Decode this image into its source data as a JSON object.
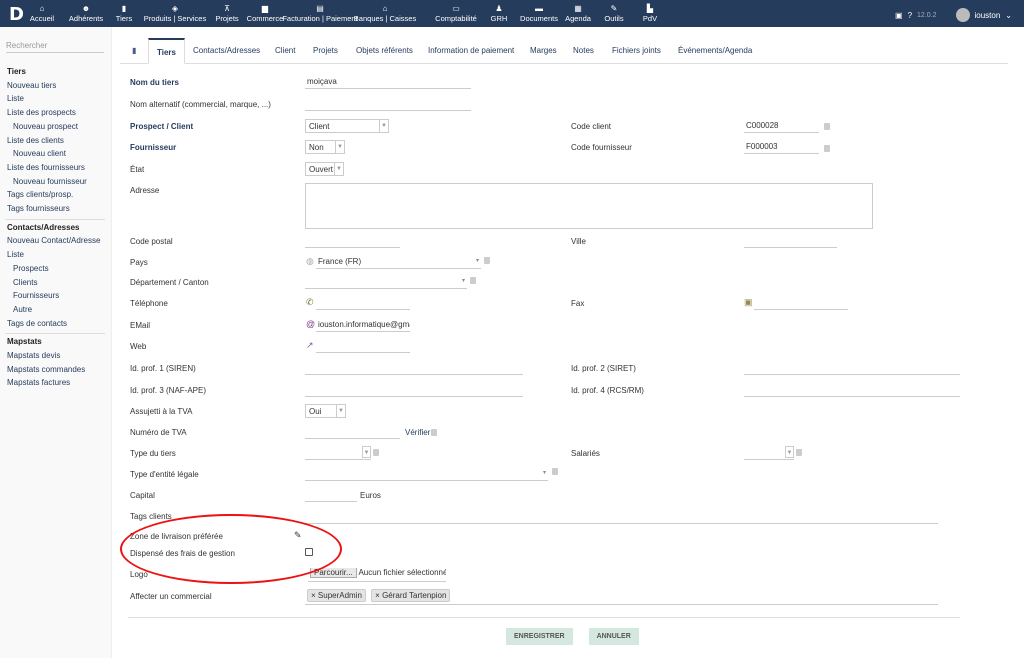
{
  "topbar": {
    "logo": "D",
    "menus": [
      {
        "label": "Accueil",
        "icon": "home-icon",
        "glyph": "⌂"
      },
      {
        "label": "Adhérents",
        "icon": "users-icon",
        "glyph": "☻"
      },
      {
        "label": "Tiers",
        "icon": "building-icon",
        "glyph": "▮",
        "active": true
      },
      {
        "label": "Produits | Services",
        "icon": "cube-icon",
        "glyph": "◈"
      },
      {
        "label": "Projets",
        "icon": "sitemap-icon",
        "glyph": "⊼"
      },
      {
        "label": "Commerce",
        "icon": "briefcase-icon",
        "glyph": "▆"
      },
      {
        "label": "Facturation | Paiement",
        "icon": "money-icon",
        "glyph": "▤"
      },
      {
        "label": "Banques | Caisses",
        "icon": "bank-icon",
        "glyph": "⌂"
      },
      {
        "label": "Comptabilité",
        "icon": "ledger-icon",
        "glyph": "▭"
      },
      {
        "label": "GRH",
        "icon": "user-tie-icon",
        "glyph": "♟"
      },
      {
        "label": "Documents",
        "icon": "folder-icon",
        "glyph": "▬"
      },
      {
        "label": "Agenda",
        "icon": "calendar-icon",
        "glyph": "▦"
      },
      {
        "label": "Outils",
        "icon": "wrench-icon",
        "glyph": "✎"
      },
      {
        "label": "PdV",
        "icon": "cash-register-icon",
        "glyph": "▙"
      }
    ],
    "version": "12.0.2",
    "user": "iouston"
  },
  "sidebar": {
    "search_placeholder": "Rechercher",
    "items": [
      {
        "label": "Tiers",
        "type": "h"
      },
      {
        "label": "Nouveau tiers"
      },
      {
        "label": "Liste"
      },
      {
        "label": "Liste des prospects"
      },
      {
        "label": "Nouveau prospect",
        "type": "sub"
      },
      {
        "label": "Liste des clients"
      },
      {
        "label": "Nouveau client",
        "type": "sub"
      },
      {
        "label": "Liste des fournisseurs"
      },
      {
        "label": "Nouveau fournisseur",
        "type": "sub"
      },
      {
        "label": "Tags clients/prosp."
      },
      {
        "label": "Tags fournisseurs"
      },
      {
        "label": "Contacts/Adresses",
        "type": "h"
      },
      {
        "label": "Nouveau Contact/Adresse"
      },
      {
        "label": "Liste"
      },
      {
        "label": "Prospects",
        "type": "sub"
      },
      {
        "label": "Clients",
        "type": "sub"
      },
      {
        "label": "Fournisseurs",
        "type": "sub"
      },
      {
        "label": "Autre",
        "type": "sub"
      },
      {
        "label": "Tags de contacts"
      },
      {
        "label": "Mapstats",
        "type": "h"
      },
      {
        "label": "Mapstats devis"
      },
      {
        "label": "Mapstats commandes"
      },
      {
        "label": "Mapstats factures"
      }
    ]
  },
  "tabs": [
    "Tiers",
    "Contacts/Adresses",
    "Client",
    "Projets",
    "Objets référents",
    "Information de paiement",
    "Marges",
    "Notes",
    "Fichiers joints",
    "Événements/Agenda"
  ],
  "form": {
    "nom_tiers": {
      "label": "Nom du tiers",
      "value": "moiçava"
    },
    "nom_alt": {
      "label": "Nom alternatif (commercial, marque, ...)"
    },
    "prospect": {
      "label": "Prospect / Client",
      "value": "Client"
    },
    "code_client": {
      "label": "Code client",
      "value": "C000028"
    },
    "fournisseur": {
      "label": "Fournisseur",
      "value": "Non"
    },
    "code_fournisseur": {
      "label": "Code fournisseur",
      "value": "F000003"
    },
    "etat": {
      "label": "État",
      "value": "Ouvert"
    },
    "adresse": {
      "label": "Adresse"
    },
    "code_postal": {
      "label": "Code postal"
    },
    "ville": {
      "label": "Ville"
    },
    "pays": {
      "label": "Pays",
      "value": "France (FR)"
    },
    "departement": {
      "label": "Département / Canton"
    },
    "telephone": {
      "label": "Téléphone"
    },
    "fax": {
      "label": "Fax"
    },
    "email": {
      "label": "EMail",
      "value": "iouston.informatique@gmai"
    },
    "web": {
      "label": "Web"
    },
    "siren": {
      "label": "Id. prof. 1 (SIREN)"
    },
    "siret": {
      "label": "Id. prof. 2 (SIRET)"
    },
    "naf": {
      "label": "Id. prof. 3 (NAF-APE)"
    },
    "rcs": {
      "label": "Id. prof. 4 (RCS/RM)"
    },
    "tva": {
      "label": "Assujetti à la TVA",
      "value": "Oui"
    },
    "num_tva": {
      "label": "Numéro de TVA",
      "verify": "Vérifier"
    },
    "type_tiers": {
      "label": "Type du tiers"
    },
    "salaries": {
      "label": "Salariés"
    },
    "entite": {
      "label": "Type d'entité légale"
    },
    "capital": {
      "label": "Capital",
      "unit": "Euros"
    },
    "tags": {
      "label": "Tags clients"
    },
    "zone": {
      "label": "Zone de livraison préférée"
    },
    "dispense": {
      "label": "Dispensé des frais de gestion",
      "checked": false
    },
    "logo": {
      "label": "Logo",
      "button": "Parcourir...",
      "status": "Aucun fichier sélectionné."
    },
    "commercial": {
      "label": "Affecter un commercial",
      "tags": [
        "SuperAdmin",
        "Gérard Tartenpion"
      ]
    }
  },
  "actions": {
    "save": "ENREGISTRER",
    "cancel": "ANNULER"
  }
}
